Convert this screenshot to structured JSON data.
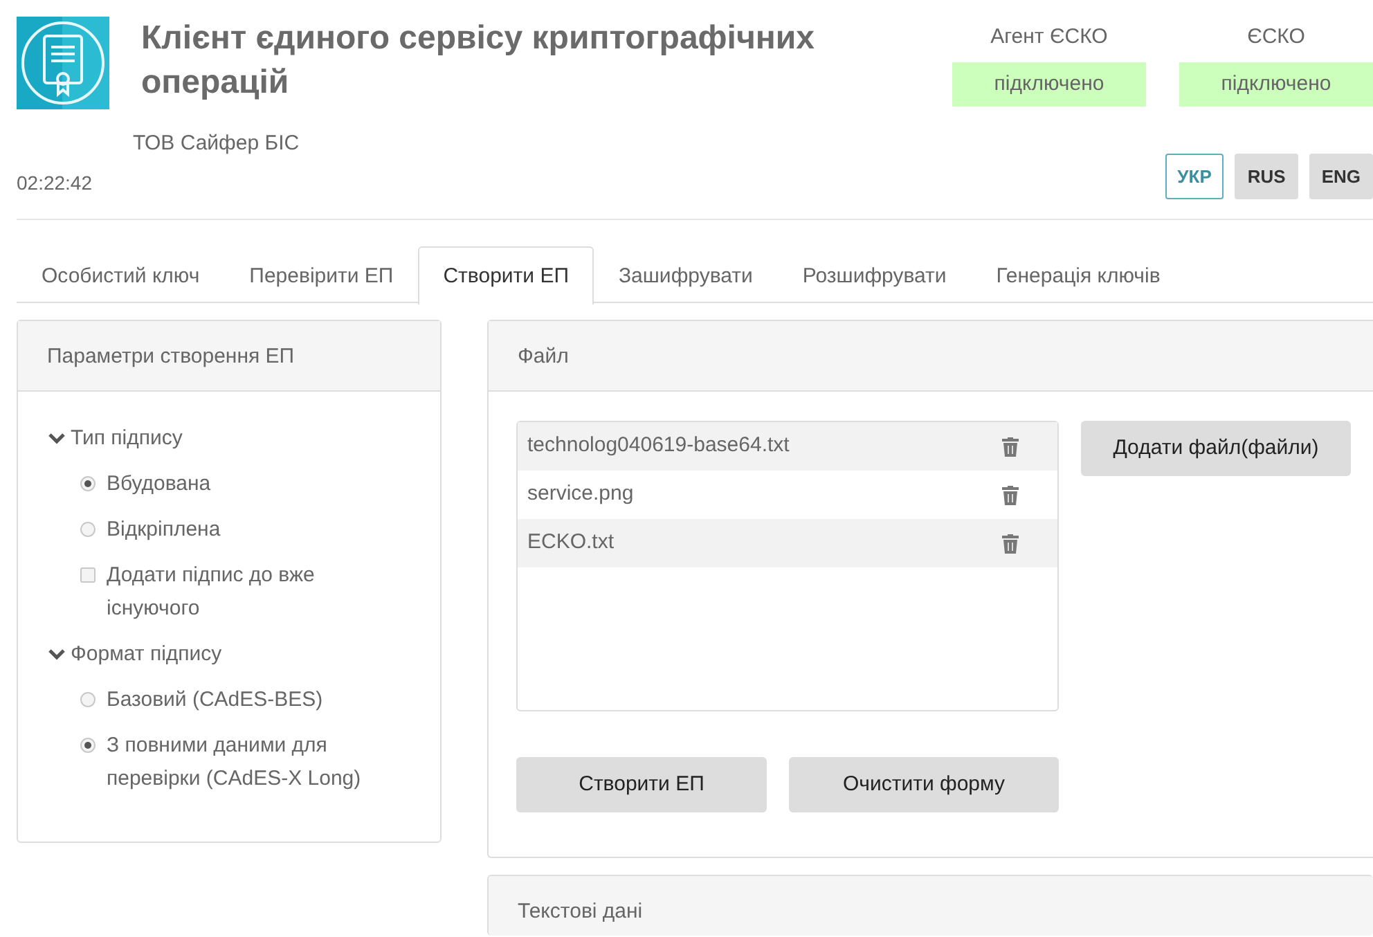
{
  "header": {
    "title": "Клієнт єдиного сервісу криптографічних операцій",
    "company": "ТОВ Сайфер БІС",
    "time": "02:22:42"
  },
  "statuses": [
    {
      "label": "Агент ЄСКО",
      "value": "підключено",
      "connected": true
    },
    {
      "label": "ЄСКО",
      "value": "підключено",
      "connected": true
    }
  ],
  "languages": [
    {
      "label": "УКР",
      "selected": true
    },
    {
      "label": "RUS",
      "selected": false
    },
    {
      "label": "ENG",
      "selected": false
    }
  ],
  "tabs": [
    {
      "label": "Особистий ключ",
      "selected": false
    },
    {
      "label": "Перевірити ЕП",
      "selected": false
    },
    {
      "label": "Створити ЕП",
      "selected": true
    },
    {
      "label": "Зашифрувати",
      "selected": false
    },
    {
      "label": "Розшифрувати",
      "selected": false
    },
    {
      "label": "Генерація ключів",
      "selected": false
    }
  ],
  "params_panel": {
    "title": "Параметри створення ЕП",
    "groups": [
      {
        "label": "Тип підпису",
        "expanded": true,
        "children": [
          {
            "kind": "radio",
            "label": "Вбудована",
            "checked": true
          },
          {
            "kind": "radio",
            "label": "Відкріплена",
            "checked": false
          },
          {
            "kind": "checkbox",
            "label": "Додати підпис до вже існуючого",
            "checked": false
          }
        ]
      },
      {
        "label": "Формат підпису",
        "expanded": true,
        "children": [
          {
            "kind": "radio",
            "label": "Базовий (CAdES-BES)",
            "checked": false
          },
          {
            "kind": "radio",
            "label": "З повними даними для перевірки (CAdES-X Long)",
            "checked": true
          }
        ]
      }
    ]
  },
  "file_panel": {
    "title": "Файл",
    "files": [
      {
        "name": "technolog040619-base64.txt"
      },
      {
        "name": "service.png"
      },
      {
        "name": "ECKO.txt"
      }
    ],
    "add_button": "Додати файл(файли)",
    "buttons": [
      "Створити ЕП",
      "Очистити форму"
    ]
  },
  "text_panel": {
    "title": "Текстові дані"
  }
}
